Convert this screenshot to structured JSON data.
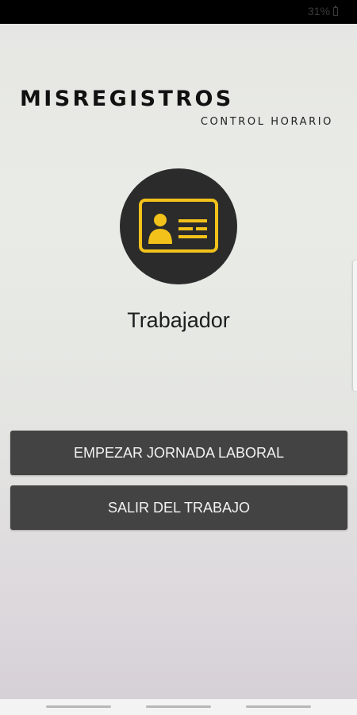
{
  "status_bar": {
    "battery": "31%"
  },
  "brand": {
    "title": "MISREGISTROS",
    "subtitle": "CONTROL HORARIO"
  },
  "avatar": {
    "icon": "id-card-icon",
    "circle_color": "#2b2b2b",
    "icon_color": "#f2c21b"
  },
  "role": {
    "label": "Trabajador"
  },
  "actions": {
    "start_label": "EMPEZAR JORNADA LABORAL",
    "exit_label": "SALIR DEL TRABAJO"
  },
  "colors": {
    "button_bg": "#434343",
    "button_text": "#f2f2f2",
    "accent": "#f2c21b"
  }
}
